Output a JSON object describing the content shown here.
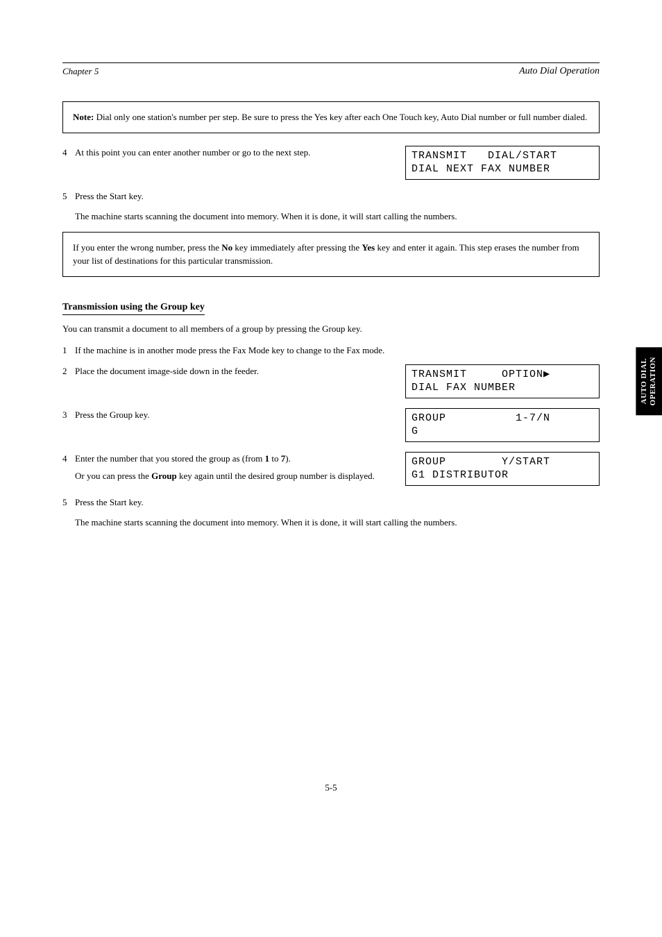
{
  "header": {
    "left": "Chapter 5",
    "right": "Auto Dial Operation"
  },
  "note_box": {
    "label": "Note:",
    "text": " Dial only one station's number per step. Be sure to press the Yes key after each One Touch key, Auto Dial number or full number dialed."
  },
  "step4": {
    "num": "4",
    "text": "At this point you can enter another number or go to the next step."
  },
  "lcd1": {
    "line1": "TRANSMIT   DIAL/START",
    "line2": "DIAL NEXT FAX NUMBER"
  },
  "step5": {
    "num": "5",
    "text": "Press the Start key."
  },
  "para1": "The machine starts scanning the document into memory. When it is done, it will start calling the numbers.",
  "wrong_note": {
    "prefix": "If you enter the wrong number, press the ",
    "bold1": "No",
    "mid": " key immediately after pressing the ",
    "bold2": "Yes",
    "suffix": " key and enter it again. This step erases the number from your list of destinations for this particular transmission."
  },
  "section_heading": "Transmission using the Group key",
  "para2": "You can transmit a document to all members of a group by pressing the Group key.",
  "stepG1": {
    "num": "1",
    "text": "If the machine is in another mode press the Fax Mode key to change to the Fax mode."
  },
  "stepG2": {
    "num": "2",
    "text": "Place the document image-side down in the feeder."
  },
  "lcd2": {
    "line1": "TRANSMIT     OPTION▶",
    "line2": "DIAL FAX NUMBER"
  },
  "stepG3": {
    "num": "3",
    "text": "Press the Group key."
  },
  "lcd3": {
    "line1": "GROUP          1-7/N",
    "line2": "G"
  },
  "stepG4": {
    "num": "4",
    "prefix": "Enter the number that you stored the group as (from ",
    "bold1": "1",
    "mid1": " to ",
    "bold2": "7",
    "suffix1": ").",
    "line2_prefix": "Or you can press the ",
    "bold3": "Group",
    "line2_suffix": " key again until the desired group number is displayed."
  },
  "lcd4": {
    "line1": "GROUP        Y/START",
    "line2": "G1 DISTRIBUTOR"
  },
  "stepG5": {
    "num": "5",
    "text": "Press the Start key."
  },
  "finalpara": "The machine starts scanning the document into memory. When it is done, it will start calling the numbers.",
  "sidetab": {
    "line1": "AUTO DIAL",
    "line2": "OPERATION"
  },
  "footer": {
    "page": "5-5"
  }
}
